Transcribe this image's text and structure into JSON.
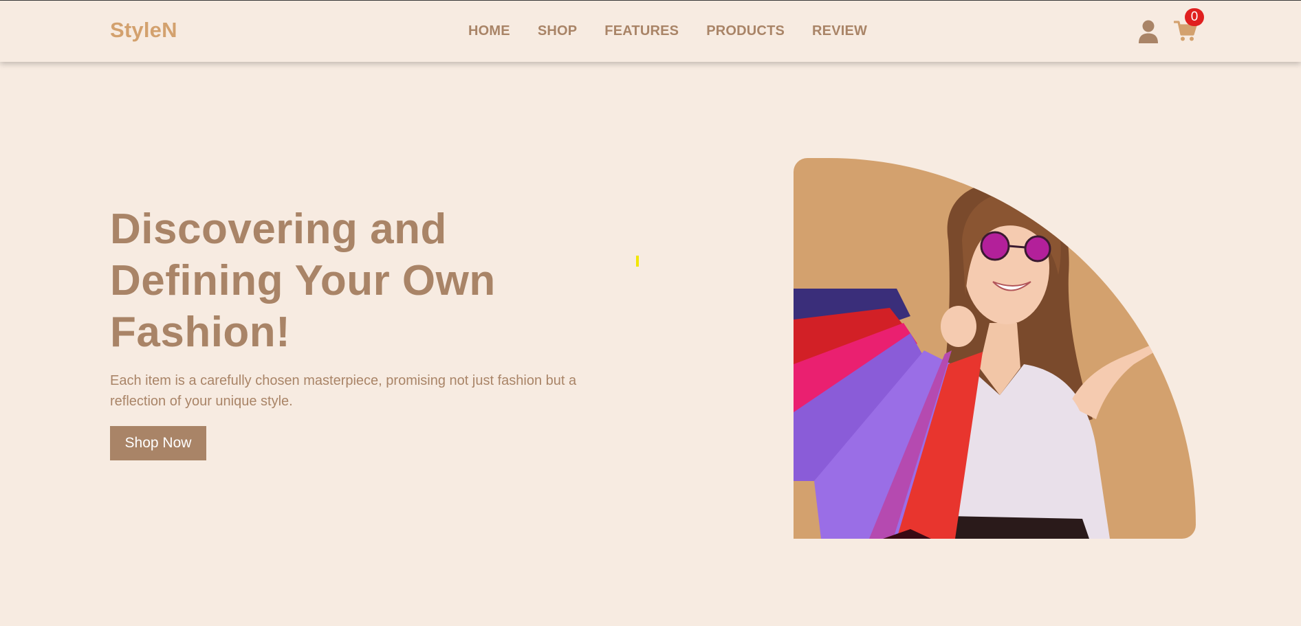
{
  "header": {
    "logo": "StyleN",
    "nav": [
      "HOME",
      "SHOP",
      "FEATURES",
      "PRODUCTS",
      "REVIEW"
    ],
    "cart_count": "0",
    "icons": {
      "user": "user-icon",
      "cart": "shopping-cart-icon"
    }
  },
  "hero": {
    "title": "Discovering and Defining Your Own Fashion!",
    "subtitle": "Each item is a carefully chosen masterpiece, promising not just fashion but a reflection of your unique style.",
    "button": "Shop Now",
    "image_alt": "woman-with-shopping-bags"
  },
  "colors": {
    "background": "#f7ebe1",
    "brand": "#d3a16e",
    "text": "#a98467",
    "badge": "#e0201f"
  }
}
